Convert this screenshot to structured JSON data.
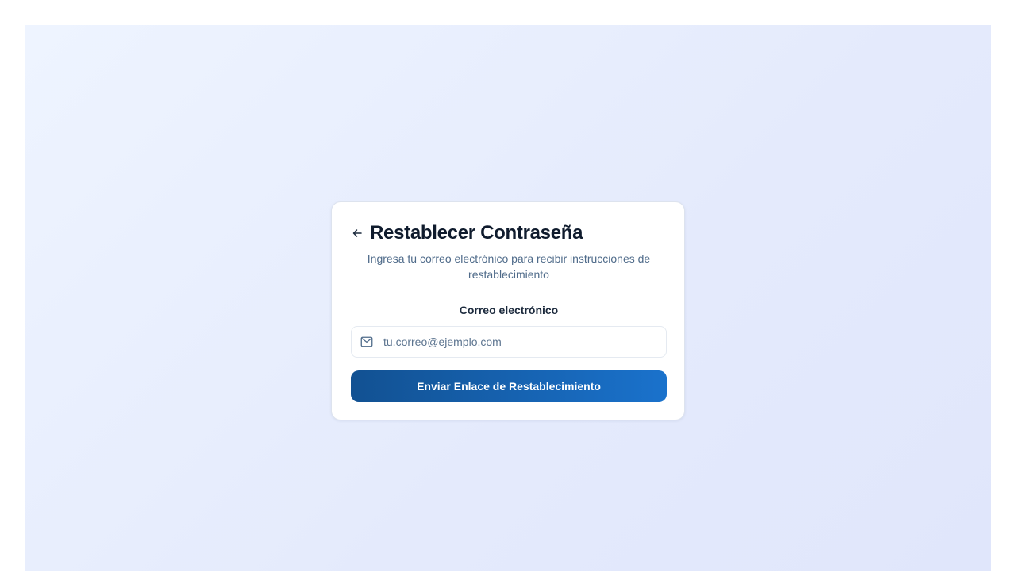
{
  "colors": {
    "background_gradient_start": "#eef4ff",
    "background_gradient_end": "#e0e6fb",
    "card_background": "#ffffff",
    "title_text": "#0f1b2d",
    "subtitle_text": "#4f6b8a",
    "button_gradient_start": "#125192",
    "button_gradient_end": "#1a72cc",
    "button_text": "#ffffff"
  },
  "reset_card": {
    "back_icon": "arrow-left-icon",
    "title": "Restablecer Contraseña",
    "subtitle": "Ingresa tu correo electrónico para recibir instrucciones de restablecimiento",
    "email_field": {
      "label": "Correo electrónico",
      "icon": "mail-icon",
      "value": "",
      "placeholder": "tu.correo@ejemplo.com"
    },
    "submit_label": "Enviar Enlace de Restablecimiento"
  }
}
